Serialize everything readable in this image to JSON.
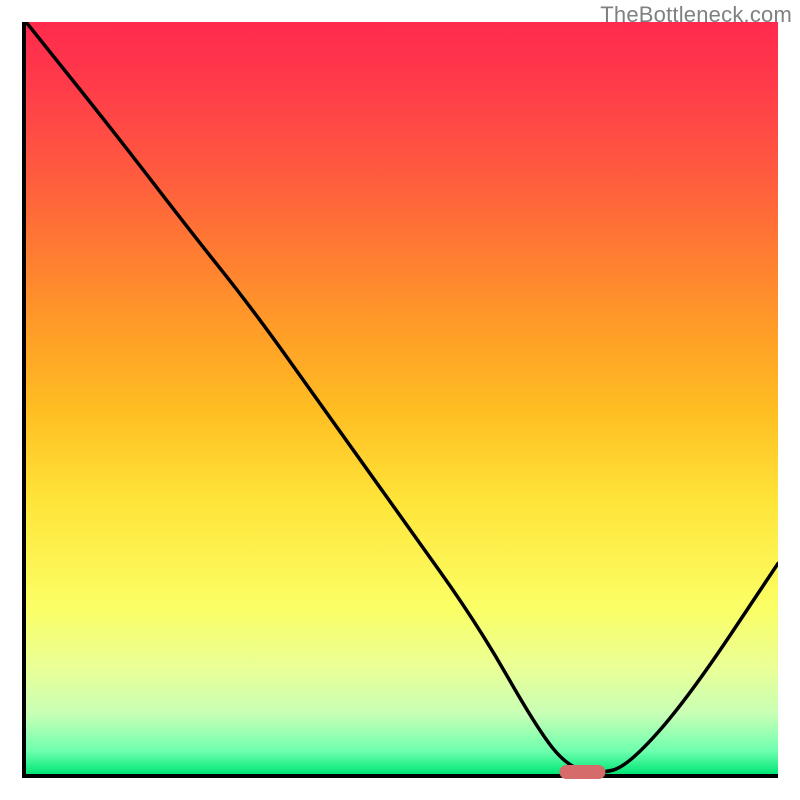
{
  "watermark": "TheBottleneck.com",
  "chart_data": {
    "type": "line",
    "title": "",
    "xlabel": "",
    "ylabel": "",
    "xlim": [
      0,
      100
    ],
    "ylim": [
      0,
      100
    ],
    "grid": false,
    "series": [
      {
        "name": "bottleneck-curve",
        "x": [
          0,
          12,
          22,
          30,
          40,
          50,
          60,
          68,
          72,
          76,
          80,
          88,
          100
        ],
        "values": [
          100,
          85,
          72,
          62,
          48,
          34,
          20,
          6,
          1,
          0,
          1,
          10,
          28
        ]
      }
    ],
    "marker": {
      "name": "optimal-range",
      "x_center": 74,
      "width_pct": 6,
      "y": 0,
      "color": "#d66b6b"
    },
    "background_gradient": {
      "top": "#ff2a4d",
      "mid": "#ffe53a",
      "bottom": "#00e676"
    }
  }
}
